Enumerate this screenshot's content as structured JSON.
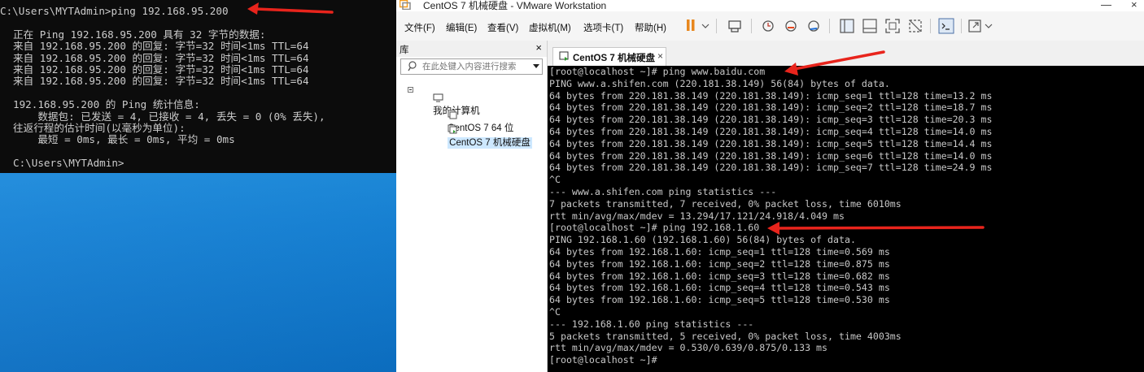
{
  "cmd": {
    "lines": [
      "C:\\Users\\MYTAdmin>ping 192.168.95.200",
      "",
      "正在 Ping 192.168.95.200 具有 32 字节的数据:",
      "来自 192.168.95.200 的回复: 字节=32 时间<1ms TTL=64",
      "来自 192.168.95.200 的回复: 字节=32 时间<1ms TTL=64",
      "来自 192.168.95.200 的回复: 字节=32 时间<1ms TTL=64",
      "来自 192.168.95.200 的回复: 字节=32 时间<1ms TTL=64",
      "",
      "192.168.95.200 的 Ping 统计信息:",
      "    数据包: 已发送 = 4, 已接收 = 4, 丢失 = 0 (0% 丢失),",
      "往返行程的估计时间(以毫秒为单位):",
      "    最短 = 0ms, 最长 = 0ms, 平均 = 0ms",
      "",
      "C:\\Users\\MYTAdmin>"
    ]
  },
  "vmware": {
    "title": "CentOS 7 机械硬盘 - VMware Workstation",
    "window_controls": {
      "minimize": "—",
      "close": "×"
    },
    "menu": [
      "文件(F)",
      "编辑(E)",
      "查看(V)",
      "虚拟机(M)",
      "选项卡(T)",
      "帮助(H)"
    ],
    "library": {
      "title": "库",
      "close": "×",
      "search_placeholder": "在此处键入内容进行搜索",
      "root": "我的计算机",
      "items": [
        "CentOS 7 64 位",
        "CentOS 7 机械硬盘"
      ]
    },
    "tab": {
      "label": "CentOS 7 机械硬盘",
      "close": "×"
    },
    "console_lines": [
      "[root@localhost ~]# ping www.baidu.com",
      "PING www.a.shifen.com (220.181.38.149) 56(84) bytes of data.",
      "64 bytes from 220.181.38.149 (220.181.38.149): icmp_seq=1 ttl=128 time=13.2 ms",
      "64 bytes from 220.181.38.149 (220.181.38.149): icmp_seq=2 ttl=128 time=18.7 ms",
      "64 bytes from 220.181.38.149 (220.181.38.149): icmp_seq=3 ttl=128 time=20.3 ms",
      "64 bytes from 220.181.38.149 (220.181.38.149): icmp_seq=4 ttl=128 time=14.0 ms",
      "64 bytes from 220.181.38.149 (220.181.38.149): icmp_seq=5 ttl=128 time=14.4 ms",
      "64 bytes from 220.181.38.149 (220.181.38.149): icmp_seq=6 ttl=128 time=14.0 ms",
      "64 bytes from 220.181.38.149 (220.181.38.149): icmp_seq=7 ttl=128 time=24.9 ms",
      "^C",
      "--- www.a.shifen.com ping statistics ---",
      "7 packets transmitted, 7 received, 0% packet loss, time 6010ms",
      "rtt min/avg/max/mdev = 13.294/17.121/24.918/4.049 ms",
      "[root@localhost ~]# ping 192.168.1.60",
      "PING 192.168.1.60 (192.168.1.60) 56(84) bytes of data.",
      "64 bytes from 192.168.1.60: icmp_seq=1 ttl=128 time=0.569 ms",
      "64 bytes from 192.168.1.60: icmp_seq=2 ttl=128 time=0.875 ms",
      "64 bytes from 192.168.1.60: icmp_seq=3 ttl=128 time=0.682 ms",
      "64 bytes from 192.168.1.60: icmp_seq=4 ttl=128 time=0.543 ms",
      "64 bytes from 192.168.1.60: icmp_seq=5 ttl=128 time=0.530 ms",
      "^C",
      "--- 192.168.1.60 ping statistics ---",
      "5 packets transmitted, 5 received, 0% packet loss, time 4003ms",
      "rtt min/avg/max/mdev = 0.530/0.639/0.875/0.133 ms",
      "[root@localhost ~]#"
    ]
  },
  "colors": {
    "annotation_arrow": "#e8241c",
    "desktop": "#1a8ee0",
    "terminal_bg": "#000000",
    "terminal_fg": "#c8c8c8",
    "selection": "#cde8ff"
  },
  "icons": [
    "vmware-logo-icon",
    "search-icon",
    "computer-icon",
    "vm-icon",
    "pause-icon",
    "send-keys-icon",
    "snapshot-icon",
    "revert-snapshot-icon",
    "snapshot-manager-icon",
    "show-library-icon",
    "thumbnail-bar-icon",
    "fullscreen-icon",
    "unity-icon",
    "console-view-icon",
    "stretch-icon"
  ]
}
